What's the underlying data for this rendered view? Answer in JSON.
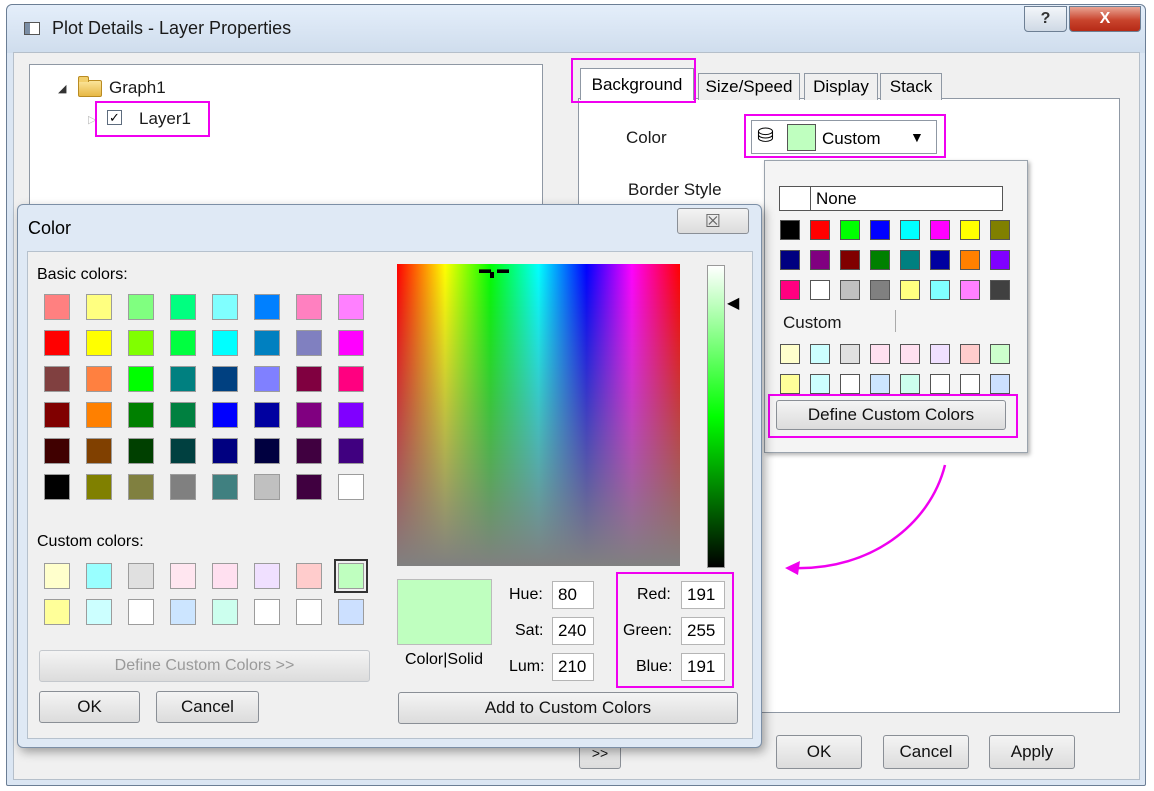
{
  "window": {
    "title": "Plot Details - Layer Properties",
    "help_label": "?",
    "close_label": "X"
  },
  "tree": {
    "root": "Graph1",
    "child": "Layer1",
    "child_checked": "✓"
  },
  "tabs": [
    {
      "label": "Background",
      "active": true
    },
    {
      "label": "Size/Speed"
    },
    {
      "label": "Display"
    },
    {
      "label": "Stack"
    }
  ],
  "background": {
    "color_label": "Color",
    "border_style_label": "Border Style",
    "color_value": "Custom",
    "color_swatch": "#bfffbf"
  },
  "color_popup": {
    "none_label": "None",
    "palette": [
      "#000000",
      "#ff0000",
      "#00ff00",
      "#0000ff",
      "#00ffff",
      "#ff00ff",
      "#ffff00",
      "#808000",
      "#000080",
      "#800080",
      "#800000",
      "#008000",
      "#008080",
      "#0000a0",
      "#ff8000",
      "#8000ff",
      "#ff0080",
      "#ffffff",
      "#c0c0c0",
      "#808080",
      "#ffff80",
      "#80ffff",
      "#ff80ff",
      "#404040"
    ],
    "custom_label": "Custom",
    "custom_colors": [
      "#ffffcc",
      "#ccffff",
      "#e0e0e0",
      "#ffe0f0",
      "#ffe0f0",
      "#f0e0ff",
      "#ffcccc",
      "#ccffcc",
      "#ffff99",
      "#ccffff",
      "#ffffff",
      "#cce5ff",
      "#ccffee",
      "#ffffff",
      "#ffffff",
      "#cce0ff"
    ],
    "define_button": "Define Custom Colors"
  },
  "color_dialog": {
    "title": "Color",
    "close_label": "☒",
    "basic_label": "Basic colors:",
    "basic_colors": [
      "#ff8080",
      "#ffff80",
      "#80ff80",
      "#00ff80",
      "#80ffff",
      "#0080ff",
      "#ff80c0",
      "#ff80ff",
      "#ff0000",
      "#ffff00",
      "#80ff00",
      "#00ff40",
      "#00ffff",
      "#0080c0",
      "#8080c0",
      "#ff00ff",
      "#804040",
      "#ff8040",
      "#00ff00",
      "#008080",
      "#004080",
      "#8080ff",
      "#800040",
      "#ff0080",
      "#800000",
      "#ff8000",
      "#008000",
      "#008040",
      "#0000ff",
      "#0000a0",
      "#800080",
      "#8000ff",
      "#400000",
      "#804000",
      "#004000",
      "#004040",
      "#000080",
      "#000040",
      "#400040",
      "#400080",
      "#000000",
      "#808000",
      "#808040",
      "#808080",
      "#408080",
      "#c0c0c0",
      "#400040",
      "#ffffff"
    ],
    "custom_label": "Custom colors:",
    "custom_colors": [
      "#ffffcc",
      "#99ffff",
      "#e0e0e0",
      "#ffe6f0",
      "#ffe0f0",
      "#f0e0ff",
      "#ffcccc",
      "#bfffbf",
      "#ffff99",
      "#ccffff",
      "#ffffff",
      "#cce5ff",
      "#ccffee",
      "#ffffff",
      "#ffffff",
      "#cce0ff"
    ],
    "define_button": "Define Custom Colors >>",
    "ok": "OK",
    "cancel": "Cancel",
    "preview_color": "#bfffbf",
    "color_solid_label": "Color|Solid",
    "hue_label": "Hue:",
    "hue": "80",
    "sat_label": "Sat:",
    "sat": "240",
    "lum_label": "Lum:",
    "lum": "210",
    "red_label": "Red:",
    "red": "191",
    "green_label": "Green:",
    "green": "255",
    "blue_label": "Blue:",
    "blue": "191",
    "add_button": "Add to Custom Colors"
  },
  "footer": {
    "expand": ">>",
    "ok": "OK",
    "cancel": "Cancel",
    "apply": "Apply"
  },
  "colors": {
    "highlight": "#f000f0"
  }
}
